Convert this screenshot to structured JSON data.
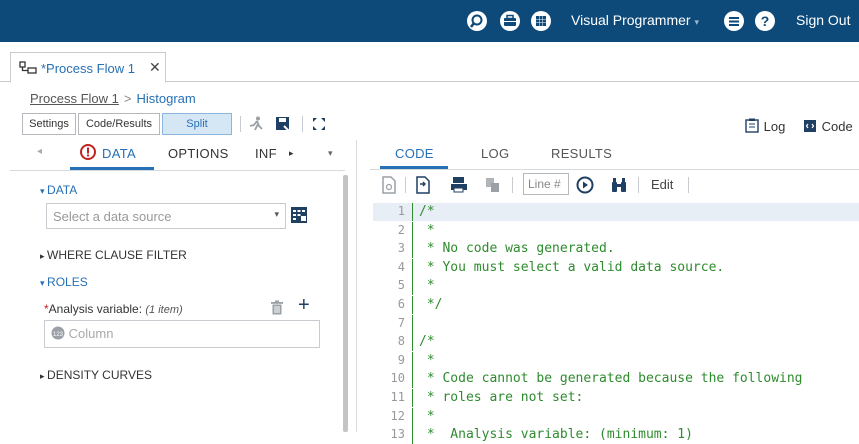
{
  "topbar": {
    "app_menu": "Visual Programmer",
    "sign_out": "Sign Out",
    "bg": "#0d4a7a"
  },
  "tab": {
    "label": "*Process Flow 1",
    "close": "✕"
  },
  "breadcrumb": {
    "root": "Process Flow 1",
    "current": "Histogram"
  },
  "toolbar": {
    "settings": "Settings",
    "code_results": "Code/Results",
    "split": "Split"
  },
  "right_buttons": {
    "log": "Log",
    "code": "Code"
  },
  "left_tabs": {
    "data": "DATA",
    "options": "OPTIONS",
    "info": "INF"
  },
  "left": {
    "data_section": "DATA",
    "data_source_placeholder": "Select a data source",
    "where_section": "WHERE CLAUSE FILTER",
    "roles_section": "ROLES",
    "analysis_label": "Analysis variable:",
    "analysis_count": "(1 item)",
    "column_placeholder": "Column",
    "density_section": "DENSITY CURVES"
  },
  "code_tabs": {
    "code": "CODE",
    "log": "LOG",
    "results": "RESULTS"
  },
  "code_toolbar": {
    "line_placeholder": "Line #",
    "edit": "Edit"
  },
  "code_lines": [
    {
      "n": "1",
      "t": "/*"
    },
    {
      "n": "2",
      "t": " *"
    },
    {
      "n": "3",
      "t": " * No code was generated."
    },
    {
      "n": "4",
      "t": " * You must select a valid data source."
    },
    {
      "n": "5",
      "t": " *"
    },
    {
      "n": "6",
      "t": " */"
    },
    {
      "n": "7",
      "t": ""
    },
    {
      "n": "8",
      "t": "/*"
    },
    {
      "n": "9",
      "t": " *"
    },
    {
      "n": "10",
      "t": " * Code cannot be generated because the following"
    },
    {
      "n": "11",
      "t": " * roles are not set:"
    },
    {
      "n": "12",
      "t": " *"
    },
    {
      "n": "13",
      "t": " *  Analysis variable: (minimum: 1)"
    }
  ]
}
